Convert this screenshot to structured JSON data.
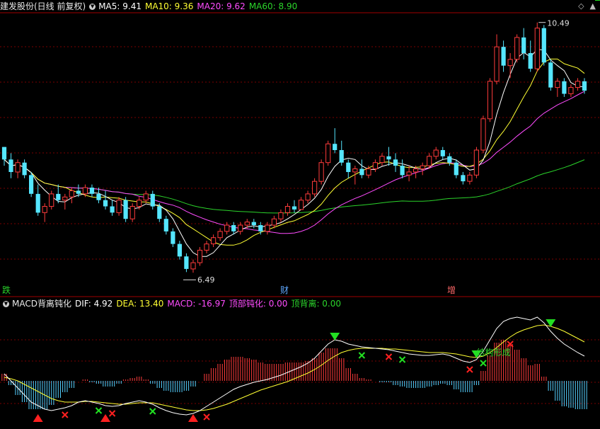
{
  "header_top": {
    "stock_name": "建发股份(日线 前复权)",
    "ma5": "MA5: 9.41",
    "ma10": "MA10: 9.36",
    "ma20": "MA20: 9.62",
    "ma60": "MA60: 8.90"
  },
  "header_bottom": {
    "indicator": "MACD背离钝化",
    "dif": "DIF: 4.92",
    "dea": "DEA: 13.40",
    "macd": "MACD: -16.97",
    "top_dull": "顶部钝化: 0.00",
    "top_div": "顶背离: 0.00"
  },
  "events": [
    {
      "label": "跌",
      "color": "#29d22a"
    },
    {
      "label": "财",
      "color": "#5fa8ff"
    },
    {
      "label": "增",
      "color": "#ff6868"
    }
  ],
  "colors": {
    "up": "#ff3b3b",
    "down": "#55e6ff",
    "ma5": "#ffffff",
    "ma10": "#ffff33",
    "ma20": "#ff4cff",
    "ma60": "#2bd42b",
    "grid": "#7a0000",
    "macd_pos": "#ff3b3b",
    "macd_neg": "#55d0ff"
  },
  "chart_data": [
    {
      "type": "candlestick",
      "high_label": "10.49",
      "low_label": "6.49",
      "ohlc": [
        [
          8.5,
          8.5,
          8.2,
          8.3
        ],
        [
          8.3,
          8.4,
          8.0,
          8.1
        ],
        [
          8.1,
          8.3,
          8.0,
          8.25
        ],
        [
          8.25,
          8.3,
          8.0,
          8.05
        ],
        [
          8.05,
          8.1,
          7.7,
          7.75
        ],
        [
          7.75,
          7.9,
          7.4,
          7.45
        ],
        [
          7.45,
          7.6,
          7.3,
          7.55
        ],
        [
          7.55,
          7.8,
          7.5,
          7.75
        ],
        [
          7.75,
          7.9,
          7.6,
          7.65
        ],
        [
          7.65,
          7.75,
          7.5,
          7.7
        ],
        [
          7.7,
          7.85,
          7.6,
          7.8
        ],
        [
          7.8,
          7.9,
          7.7,
          7.75
        ],
        [
          7.75,
          7.9,
          7.7,
          7.85
        ],
        [
          7.85,
          7.9,
          7.7,
          7.75
        ],
        [
          7.75,
          7.85,
          7.6,
          7.65
        ],
        [
          7.65,
          7.8,
          7.5,
          7.55
        ],
        [
          7.55,
          7.65,
          7.4,
          7.45
        ],
        [
          7.45,
          7.7,
          7.4,
          7.65
        ],
        [
          7.65,
          7.7,
          7.3,
          7.35
        ],
        [
          7.35,
          7.6,
          7.3,
          7.55
        ],
        [
          7.55,
          7.7,
          7.5,
          7.65
        ],
        [
          7.65,
          7.8,
          7.6,
          7.75
        ],
        [
          7.75,
          7.8,
          7.5,
          7.55
        ],
        [
          7.55,
          7.6,
          7.3,
          7.35
        ],
        [
          7.35,
          7.4,
          7.1,
          7.15
        ],
        [
          7.15,
          7.2,
          6.9,
          6.95
        ],
        [
          6.95,
          7.0,
          6.7,
          6.75
        ],
        [
          6.75,
          6.8,
          6.5,
          6.55
        ],
        [
          6.55,
          6.7,
          6.49,
          6.65
        ],
        [
          6.65,
          6.9,
          6.6,
          6.85
        ],
        [
          6.85,
          7.0,
          6.8,
          6.95
        ],
        [
          6.95,
          7.1,
          6.9,
          7.05
        ],
        [
          7.05,
          7.2,
          7.0,
          7.15
        ],
        [
          7.15,
          7.3,
          7.1,
          7.25
        ],
        [
          7.25,
          7.3,
          7.1,
          7.15
        ],
        [
          7.15,
          7.3,
          7.1,
          7.25
        ],
        [
          7.25,
          7.35,
          7.2,
          7.3
        ],
        [
          7.3,
          7.35,
          7.2,
          7.25
        ],
        [
          7.25,
          7.3,
          7.1,
          7.15
        ],
        [
          7.15,
          7.3,
          7.1,
          7.25
        ],
        [
          7.25,
          7.4,
          7.2,
          7.35
        ],
        [
          7.35,
          7.5,
          7.3,
          7.45
        ],
        [
          7.45,
          7.6,
          7.4,
          7.55
        ],
        [
          7.55,
          7.65,
          7.45,
          7.5
        ],
        [
          7.5,
          7.7,
          7.5,
          7.65
        ],
        [
          7.65,
          7.8,
          7.6,
          7.75
        ],
        [
          7.75,
          8.0,
          7.7,
          7.95
        ],
        [
          7.95,
          8.3,
          7.9,
          8.25
        ],
        [
          8.25,
          8.6,
          8.2,
          8.55
        ],
        [
          8.55,
          8.8,
          8.4,
          8.45
        ],
        [
          8.45,
          8.6,
          8.2,
          8.25
        ],
        [
          8.25,
          8.3,
          8.0,
          8.1
        ],
        [
          8.1,
          8.2,
          7.9,
          8.15
        ],
        [
          8.15,
          8.3,
          8.0,
          8.05
        ],
        [
          8.05,
          8.2,
          8.0,
          8.15
        ],
        [
          8.15,
          8.3,
          8.1,
          8.25
        ],
        [
          8.25,
          8.4,
          8.2,
          8.35
        ],
        [
          8.35,
          8.5,
          8.2,
          8.3
        ],
        [
          8.3,
          8.4,
          8.1,
          8.2
        ],
        [
          8.2,
          8.3,
          8.0,
          8.05
        ],
        [
          8.05,
          8.2,
          7.95,
          8.1
        ],
        [
          8.1,
          8.2,
          8.0,
          8.15
        ],
        [
          8.15,
          8.25,
          8.05,
          8.2
        ],
        [
          8.2,
          8.4,
          8.15,
          8.35
        ],
        [
          8.35,
          8.5,
          8.3,
          8.45
        ],
        [
          8.45,
          8.5,
          8.3,
          8.35
        ],
        [
          8.35,
          8.4,
          8.2,
          8.25
        ],
        [
          8.25,
          8.3,
          8.0,
          8.05
        ],
        [
          8.05,
          8.1,
          7.9,
          7.95
        ],
        [
          7.95,
          8.1,
          7.9,
          8.05
        ],
        [
          8.05,
          8.5,
          8.0,
          8.45
        ],
        [
          8.45,
          9.0,
          8.4,
          8.95
        ],
        [
          8.95,
          9.6,
          8.9,
          9.55
        ],
        [
          9.55,
          10.3,
          9.5,
          10.1
        ],
        [
          10.1,
          10.2,
          9.7,
          9.8
        ],
        [
          9.8,
          10.0,
          9.6,
          9.9
        ],
        [
          9.9,
          10.3,
          9.85,
          10.25
        ],
        [
          10.25,
          10.4,
          9.9,
          10.0
        ],
        [
          10.0,
          10.2,
          9.7,
          9.75
        ],
        [
          9.75,
          10.49,
          9.7,
          10.4
        ],
        [
          10.4,
          10.45,
          9.8,
          9.85
        ],
        [
          9.85,
          9.9,
          9.4,
          9.45
        ],
        [
          9.45,
          9.6,
          9.3,
          9.55
        ],
        [
          9.55,
          9.6,
          9.3,
          9.35
        ],
        [
          9.35,
          9.5,
          9.3,
          9.45
        ],
        [
          9.45,
          9.6,
          9.4,
          9.55
        ],
        [
          9.55,
          9.6,
          9.35,
          9.4
        ]
      ]
    },
    {
      "type": "macd",
      "dif": [
        0.1,
        0.0,
        -0.1,
        -0.2,
        -0.3,
        -0.35,
        -0.4,
        -0.42,
        -0.4,
        -0.38,
        -0.35,
        -0.3,
        -0.28,
        -0.3,
        -0.32,
        -0.35,
        -0.36,
        -0.35,
        -0.32,
        -0.3,
        -0.28,
        -0.3,
        -0.33,
        -0.38,
        -0.42,
        -0.45,
        -0.47,
        -0.48,
        -0.46,
        -0.42,
        -0.36,
        -0.3,
        -0.24,
        -0.18,
        -0.12,
        -0.08,
        -0.05,
        -0.02,
        0.0,
        0.02,
        0.05,
        0.08,
        0.12,
        0.16,
        0.2,
        0.25,
        0.32,
        0.42,
        0.52,
        0.58,
        0.56,
        0.52,
        0.5,
        0.48,
        0.47,
        0.46,
        0.45,
        0.44,
        0.42,
        0.4,
        0.38,
        0.37,
        0.36,
        0.36,
        0.37,
        0.38,
        0.36,
        0.32,
        0.28,
        0.26,
        0.3,
        0.42,
        0.58,
        0.74,
        0.84,
        0.88,
        0.9,
        0.88,
        0.86,
        0.9,
        0.82,
        0.7,
        0.6,
        0.52,
        0.46,
        0.4,
        0.35
      ],
      "dea": [
        0.05,
        0.03,
        0.0,
        -0.05,
        -0.1,
        -0.15,
        -0.2,
        -0.25,
        -0.28,
        -0.3,
        -0.3,
        -0.3,
        -0.29,
        -0.29,
        -0.3,
        -0.31,
        -0.32,
        -0.33,
        -0.33,
        -0.32,
        -0.31,
        -0.31,
        -0.31,
        -0.33,
        -0.35,
        -0.37,
        -0.39,
        -0.41,
        -0.42,
        -0.42,
        -0.41,
        -0.39,
        -0.36,
        -0.33,
        -0.29,
        -0.25,
        -0.21,
        -0.17,
        -0.13,
        -0.1,
        -0.07,
        -0.04,
        -0.01,
        0.03,
        0.07,
        0.11,
        0.16,
        0.22,
        0.29,
        0.35,
        0.4,
        0.43,
        0.45,
        0.46,
        0.46,
        0.46,
        0.46,
        0.45,
        0.45,
        0.44,
        0.43,
        0.42,
        0.41,
        0.4,
        0.4,
        0.4,
        0.39,
        0.38,
        0.36,
        0.34,
        0.33,
        0.35,
        0.4,
        0.47,
        0.55,
        0.62,
        0.68,
        0.72,
        0.75,
        0.78,
        0.79,
        0.77,
        0.74,
        0.7,
        0.65,
        0.6,
        0.55
      ],
      "markers": [
        {
          "i": 5,
          "kind": "up-triangle"
        },
        {
          "i": 9,
          "kind": "red-x"
        },
        {
          "i": 14,
          "kind": "green-x"
        },
        {
          "i": 15,
          "kind": "up-triangle"
        },
        {
          "i": 16,
          "kind": "red-x"
        },
        {
          "i": 22,
          "kind": "green-x"
        },
        {
          "i": 28,
          "kind": "up-triangle"
        },
        {
          "i": 30,
          "kind": "red-x"
        },
        {
          "i": 49,
          "kind": "down-triangle"
        },
        {
          "i": 53,
          "kind": "green-x"
        },
        {
          "i": 57,
          "kind": "red-x"
        },
        {
          "i": 59,
          "kind": "green-x"
        },
        {
          "i": 69,
          "kind": "red-x"
        },
        {
          "i": 70,
          "kind": "down-triangle"
        },
        {
          "i": 71,
          "kind": "green-x"
        },
        {
          "i": 75,
          "kind": "red-x"
        },
        {
          "i": 81,
          "kind": "down-triangle"
        },
        {
          "i": 87,
          "kind": "down-triangle"
        },
        {
          "i": 88,
          "kind": "green-x"
        }
      ],
      "annotation": "结构形成"
    }
  ]
}
